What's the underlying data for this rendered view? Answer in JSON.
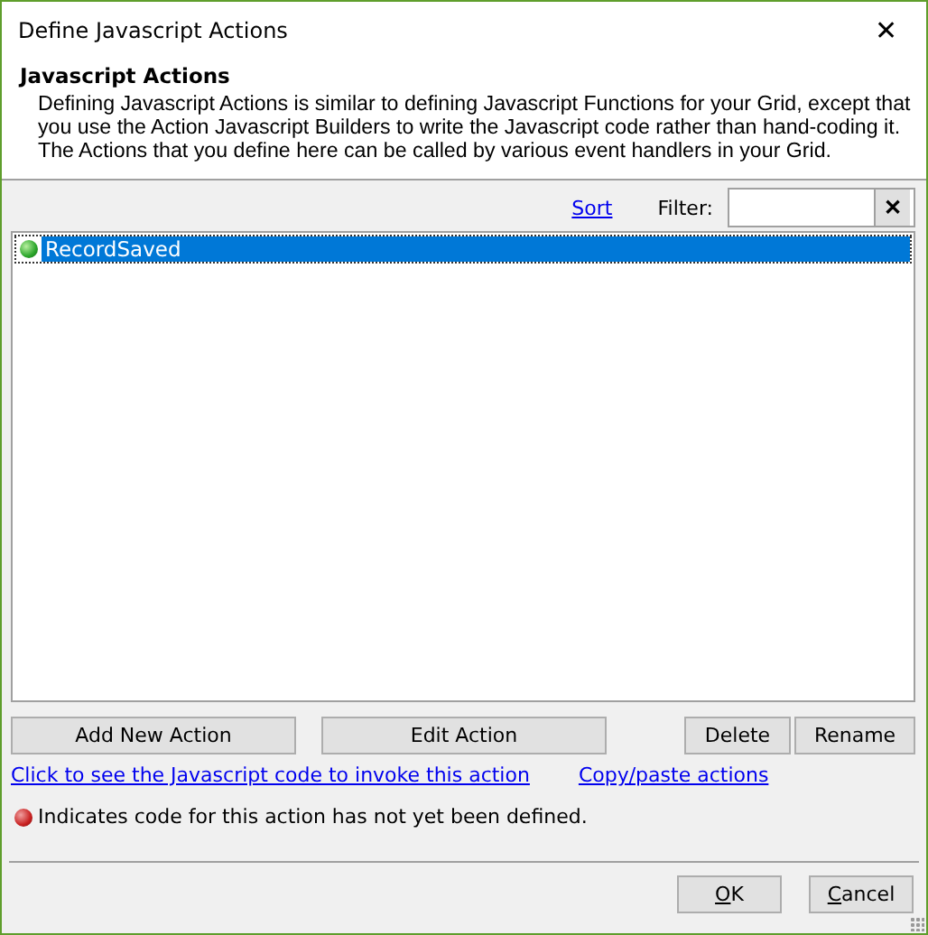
{
  "window": {
    "title": "Define Javascript Actions",
    "close": "✕"
  },
  "header": {
    "title": "Javascript Actions",
    "description": "Defining Javascript Actions is similar to defining Javascript Functions for your Grid, except that you use the Action Javascript Builders to write the Javascript code rather than hand-coding it. The Actions that you define here can be called by various event handlers in your Grid."
  },
  "toolbar": {
    "sort": "Sort",
    "filter_label": "Filter:",
    "clear": "✕"
  },
  "actions": [
    {
      "name": "RecordSaved",
      "defined": true,
      "selected": true
    }
  ],
  "buttons": [
    "Add New Action",
    "Edit Action",
    "Delete",
    "Rename"
  ],
  "links": [
    "Click to see the Javascript code to invoke this action",
    "Copy/paste actions"
  ],
  "legend": "Indicates code for this action has not yet been defined.",
  "footer_buttons": [
    {
      "label": "OK",
      "first_letter_underlined": true
    },
    {
      "label": "Cancel",
      "first_letter_underlined": true
    }
  ]
}
